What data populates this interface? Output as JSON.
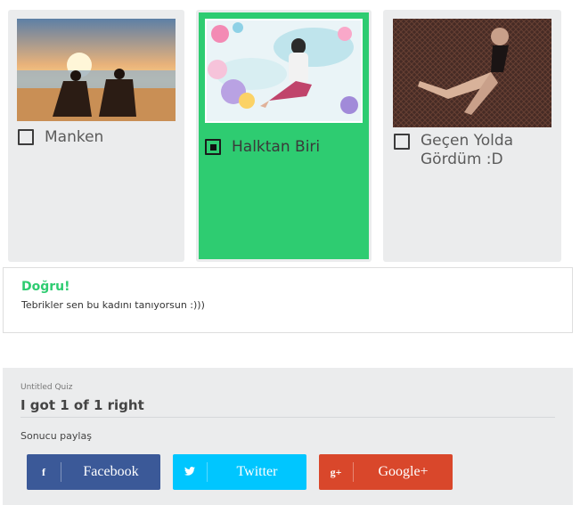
{
  "options": [
    {
      "label": "Manken",
      "selected": false
    },
    {
      "label": "Halktan Biri",
      "selected": true
    },
    {
      "label": "Geçen Yolda Gördüm :D",
      "selected": false
    }
  ],
  "result": {
    "title": "Doğru!",
    "message": "Tebrikler sen bu kadını tanıyorsun :)))"
  },
  "share": {
    "quiz_name": "Untitled Quiz",
    "score": "I got 1 of 1 right",
    "label": "Sonucu paylaş",
    "buttons": [
      {
        "label": "Facebook",
        "icon": "f"
      },
      {
        "label": "Twitter",
        "icon": "twitter-bird"
      },
      {
        "label": "Google+",
        "icon": "g+"
      }
    ]
  },
  "colors": {
    "correct_green": "#2ecc71",
    "facebook": "#3b5998",
    "twitter": "#00c6ff",
    "google": "#d9472b",
    "card_bg": "#ebeced"
  }
}
